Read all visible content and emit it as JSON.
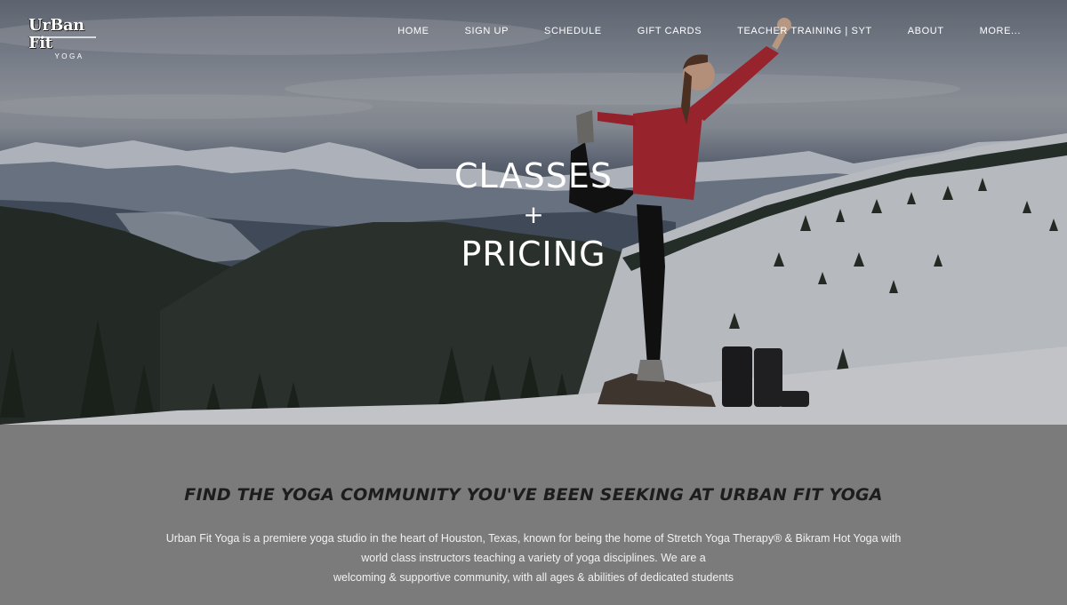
{
  "brand": {
    "logo_word": "UrBan Fit",
    "logo_sub": "YOGA"
  },
  "nav": {
    "items": [
      {
        "label": "HOME"
      },
      {
        "label": "SIGN UP"
      },
      {
        "label": "SCHEDULE"
      },
      {
        "label": "GIFT CARDS"
      },
      {
        "label": "TEACHER TRAINING | SYT"
      },
      {
        "label": "ABOUT"
      },
      {
        "label": "MORE..."
      }
    ]
  },
  "hero": {
    "title_line1": "CLASSES",
    "title_plus": "+",
    "title_line2": "PRICING",
    "image": "yoga-pose-mountain-photo"
  },
  "intro": {
    "heading": "FIND THE YOGA COMMUNITY YOU'VE BEEN SEEKING AT URBAN FIT YOGA",
    "line1": "Urban Fit Yoga is a premiere yoga studio in the heart of Houston, Texas, known for being the home of Stretch Yoga Therapy® & Bikram Hot Yoga with",
    "line2": "world class instructors teaching a variety of yoga disciplines. We are a",
    "line3": "welcoming & supportive community, with all ages & abilities of dedicated students"
  },
  "colors": {
    "content_bg": "#7b7b7b",
    "heading_text": "#1d1d1d",
    "nav_text": "#ffffff",
    "jacket_red": "#b42a35"
  }
}
